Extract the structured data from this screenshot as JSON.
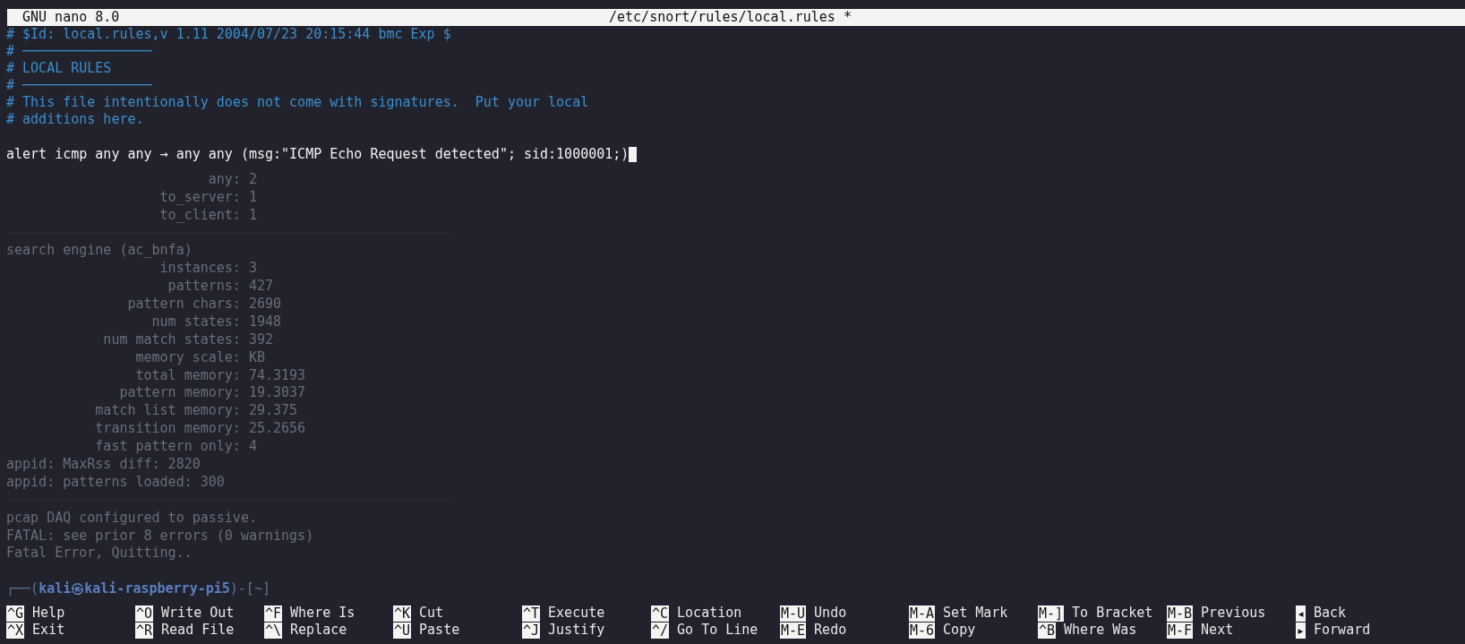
{
  "title_bar": {
    "app": "GNU nano 8.0",
    "file": "/etc/snort/rules/local.rules *"
  },
  "lines": [
    {
      "kind": "comment",
      "text": "# $Id: local.rules,v 1.11 2004/07/23 20:15:44 bmc Exp $"
    },
    {
      "kind": "comment",
      "text": "# ────────────────"
    },
    {
      "kind": "comment",
      "text": "# LOCAL RULES"
    },
    {
      "kind": "comment",
      "text": "# ────────────────"
    },
    {
      "kind": "comment",
      "text": "# This file intentionally does not come with signatures.  Put your local"
    },
    {
      "kind": "comment",
      "text": "# additions here."
    },
    {
      "kind": "blank"
    },
    {
      "kind": "code",
      "text": "alert icmp any any → any any (msg:\"ICMP Echo Request detected\"; sid:1000001;)",
      "cursor": true
    }
  ],
  "background_text": [
    {
      "kind": "stat",
      "label": "any:",
      "value": "2"
    },
    {
      "kind": "stat",
      "label": "to_server:",
      "value": "1"
    },
    {
      "kind": "stat",
      "label": "to_client:",
      "value": "1"
    },
    {
      "kind": "divider"
    },
    {
      "kind": "line",
      "text": "search engine (ac_bnfa)"
    },
    {
      "kind": "stat",
      "label": "instances:",
      "value": "3"
    },
    {
      "kind": "stat",
      "label": "patterns:",
      "value": "427"
    },
    {
      "kind": "stat",
      "label": "pattern chars:",
      "value": "2690"
    },
    {
      "kind": "stat",
      "label": "num states:",
      "value": "1948"
    },
    {
      "kind": "stat",
      "label": "num match states:",
      "value": "392"
    },
    {
      "kind": "stat",
      "label": "memory scale:",
      "value": "KB"
    },
    {
      "kind": "stat",
      "label": "total memory:",
      "value": "74.3193"
    },
    {
      "kind": "stat",
      "label": "pattern memory:",
      "value": "19.3037"
    },
    {
      "kind": "stat",
      "label": "match list memory:",
      "value": "29.375"
    },
    {
      "kind": "stat",
      "label": "transition memory:",
      "value": "25.2656"
    },
    {
      "kind": "stat",
      "label": "fast pattern only:",
      "value": "4"
    },
    {
      "kind": "line",
      "text": "appid: MaxRss diff: 2820"
    },
    {
      "kind": "line",
      "text": "appid: patterns loaded: 300"
    },
    {
      "kind": "divider"
    },
    {
      "kind": "line",
      "text": "pcap DAQ configured to passive."
    },
    {
      "kind": "line",
      "text": "FATAL: see prior 8 errors (0 warnings)"
    },
    {
      "kind": "line",
      "text": "Fatal Error, Quitting.."
    },
    {
      "kind": "blank"
    },
    {
      "kind": "prompt",
      "text": "┌──(**kali㉿kali-raspberry-pi5**)-[~]"
    }
  ],
  "shortcuts": [
    {
      "key": "^G",
      "label": "Help"
    },
    {
      "key": "^X",
      "label": "Exit"
    },
    {
      "key": "^O",
      "label": "Write Out"
    },
    {
      "key": "^R",
      "label": "Read File"
    },
    {
      "key": "^F",
      "label": "Where Is"
    },
    {
      "key": "^\\",
      "label": "Replace"
    },
    {
      "key": "^K",
      "label": "Cut"
    },
    {
      "key": "^U",
      "label": "Paste"
    },
    {
      "key": "^T",
      "label": "Execute"
    },
    {
      "key": "^J",
      "label": "Justify"
    },
    {
      "key": "^C",
      "label": "Location"
    },
    {
      "key": "^/",
      "label": "Go To Line"
    },
    {
      "key": "M-U",
      "label": "Undo"
    },
    {
      "key": "M-E",
      "label": "Redo"
    },
    {
      "key": "M-A",
      "label": "Set Mark"
    },
    {
      "key": "M-6",
      "label": "Copy"
    },
    {
      "key": "M-]",
      "label": "To Bracket"
    },
    {
      "key": "^B",
      "label": "Where Was"
    },
    {
      "key": "M-B",
      "label": "Previous"
    },
    {
      "key": "M-F",
      "label": "Next"
    },
    {
      "key": "◂",
      "label": "Back"
    },
    {
      "key": "▸",
      "label": "Forward"
    }
  ]
}
